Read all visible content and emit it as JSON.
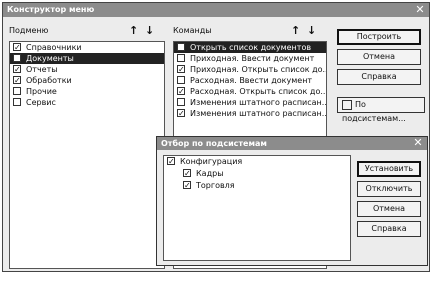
{
  "main_window": {
    "title": "Конструктор меню",
    "left_panel": {
      "header": "Подменю",
      "items": [
        {
          "label": "Справочники",
          "checked": true,
          "selected": false
        },
        {
          "label": "Документы",
          "checked": true,
          "selected": true
        },
        {
          "label": "Отчеты",
          "checked": true,
          "selected": false
        },
        {
          "label": "Обработки",
          "checked": true,
          "selected": false
        },
        {
          "label": "Прочие",
          "checked": false,
          "selected": false
        },
        {
          "label": "Сервис",
          "checked": false,
          "selected": false
        }
      ]
    },
    "right_panel": {
      "header": "Команды",
      "items": [
        {
          "label": "Открыть список документов",
          "checked": false,
          "selected": true
        },
        {
          "label": "Приходная. Ввести документ",
          "checked": false,
          "selected": false
        },
        {
          "label": "Приходная. Открыть список до...",
          "checked": true,
          "selected": false
        },
        {
          "label": "Расходная. Ввести документ",
          "checked": false,
          "selected": false
        },
        {
          "label": "Расходная. Открыть список до...",
          "checked": true,
          "selected": false
        },
        {
          "label": "Изменения штатного расписан...",
          "checked": false,
          "selected": false
        },
        {
          "label": "Изменения штатного расписан...",
          "checked": true,
          "selected": false
        }
      ]
    },
    "buttons": {
      "build": "Построить",
      "cancel": "Отмена",
      "help": "Справка",
      "by_subsystems": "По подсистемам..."
    }
  },
  "dialog": {
    "title": "Отбор по подсистемам",
    "tree": [
      {
        "label": "Конфигурация",
        "checked": true,
        "level": 0
      },
      {
        "label": "Кадры",
        "checked": true,
        "level": 1
      },
      {
        "label": "Торговля",
        "checked": true,
        "level": 1
      }
    ],
    "buttons": {
      "set_all": "Установить",
      "clear_all": "Отключить",
      "cancel": "Отмена",
      "help": "Справка"
    }
  }
}
